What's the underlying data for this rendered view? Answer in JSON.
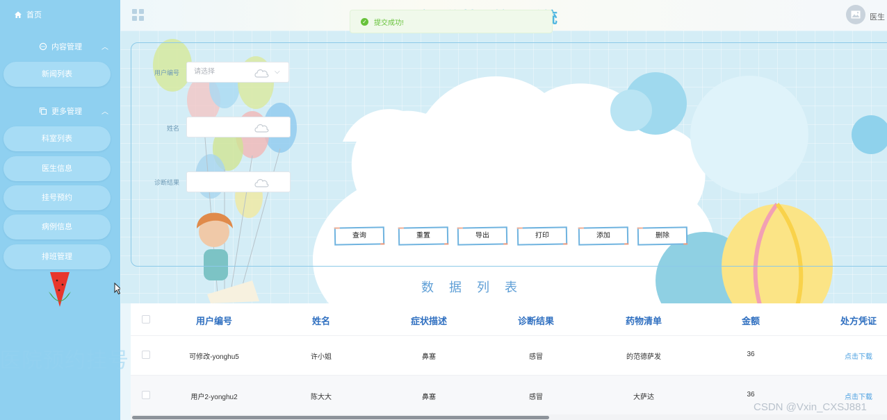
{
  "sidebar": {
    "home_label": "首页",
    "groups": [
      {
        "label": "内容管理",
        "items": [
          "新闻列表"
        ]
      },
      {
        "label": "更多管理",
        "items": [
          "科室列表",
          "医生信息",
          "挂号预约",
          "病例信息",
          "排班管理"
        ]
      }
    ],
    "background_text": "医院预约挂号"
  },
  "header": {
    "title": "医院预约挂号管理系统",
    "user_role": "医生"
  },
  "toast": {
    "message": "提交成功!"
  },
  "search_form": {
    "fields": [
      {
        "label": "用户编号",
        "placeholder": "请选择",
        "type": "select"
      },
      {
        "label": "姓名",
        "placeholder": "",
        "type": "input"
      },
      {
        "label": "诊断结果",
        "placeholder": "",
        "type": "input"
      }
    ],
    "buttons": [
      "查询",
      "重置",
      "导出",
      "打印",
      "添加",
      "删除"
    ]
  },
  "list_title": "数据列表",
  "table": {
    "columns": [
      "用户编号",
      "姓名",
      "症状描述",
      "诊断结果",
      "药物清单",
      "金额",
      "处方凭证"
    ],
    "rows": [
      [
        "可修改-yonghu5",
        "许小姐",
        "鼻塞",
        "感冒",
        "的范德萨发",
        "36",
        "点击下载"
      ],
      [
        "用户2-yonghu2",
        "陈大大",
        "鼻塞",
        "感冒",
        "大萨达",
        "36",
        "点击下载"
      ]
    ]
  },
  "watermark": "CSDN @Vxin_CXSJ881",
  "colors": {
    "sidebar_bg": "#8fd0f0",
    "accent": "#2f6fc0",
    "success": "#67c23a",
    "link": "#4a9fe0"
  }
}
